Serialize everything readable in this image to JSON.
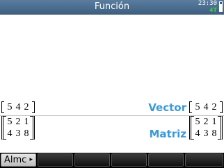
{
  "titlebar": {
    "title": "Función",
    "time": "23:30",
    "angle_mode": "4T",
    "battery_icon": "battery-icon"
  },
  "history": {
    "entries": [
      {
        "input": [
          [
            5,
            4,
            2
          ]
        ],
        "label": "Vector",
        "output": [
          [
            5,
            4,
            2
          ]
        ]
      },
      {
        "input": [
          [
            5,
            2,
            1
          ],
          [
            4,
            3,
            8
          ]
        ],
        "label": "Matriz",
        "output": [
          [
            5,
            2,
            1
          ],
          [
            4,
            3,
            8
          ]
        ]
      }
    ]
  },
  "menu": {
    "keys": [
      {
        "label": "Almc",
        "arrow": "▸"
      },
      {
        "label": ""
      },
      {
        "label": ""
      },
      {
        "label": ""
      },
      {
        "label": ""
      },
      {
        "label": ""
      }
    ]
  },
  "colors": {
    "titlebar": "#4a6d90",
    "label_blue": "#3a9ad9",
    "angle_green": "#48c848"
  }
}
